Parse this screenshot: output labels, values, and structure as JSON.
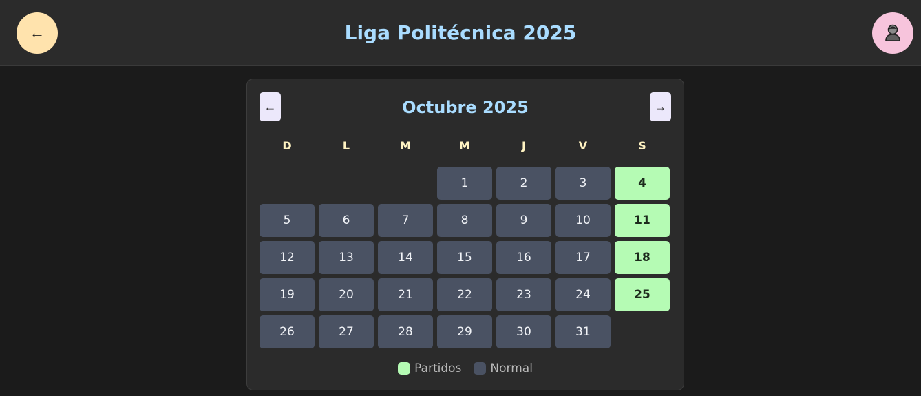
{
  "header": {
    "title": "Liga Politécnica 2025",
    "back_icon": "←",
    "profile_icon": "user-avatar-icon"
  },
  "calendar": {
    "month_title": "Octubre 2025",
    "prev_label": "←",
    "next_label": "→",
    "weekdays": [
      "D",
      "L",
      "M",
      "M",
      "J",
      "V",
      "S"
    ],
    "leading_empty": 3,
    "days": [
      "1",
      "2",
      "3",
      "4",
      "5",
      "6",
      "7",
      "8",
      "9",
      "10",
      "11",
      "12",
      "13",
      "14",
      "15",
      "16",
      "17",
      "18",
      "19",
      "20",
      "21",
      "22",
      "23",
      "24",
      "25",
      "26",
      "27",
      "28",
      "29",
      "30",
      "31"
    ],
    "match_days": [
      "4",
      "11",
      "18",
      "25"
    ]
  },
  "legend": {
    "match_label": "Partidos",
    "normal_label": "Normal"
  },
  "colors": {
    "accent_title": "#a9dcff",
    "match": "#b5fbb4",
    "normal": "#4a5263",
    "weekday": "#fff3c2"
  }
}
